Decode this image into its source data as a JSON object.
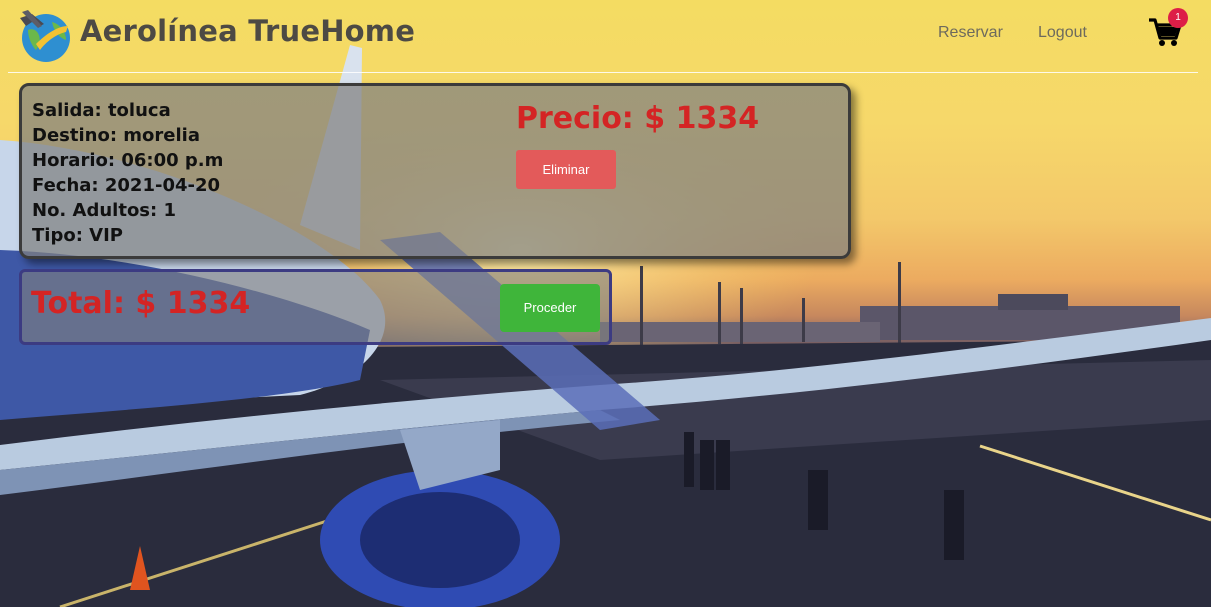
{
  "brand": {
    "name": "Aerolínea TrueHome",
    "logo_icon": "plane-globe-icon"
  },
  "nav": {
    "reservar": "Reservar",
    "logout": "Logout",
    "cart_icon": "shopping-cart-icon",
    "cart_count": "1"
  },
  "reservation": {
    "salida": "Salida: toluca",
    "destino": "Destino: morelia",
    "horario": "Horario: 06:00 p.m",
    "fecha": "Fecha: 2021-04-20",
    "adultos": "No. Adultos: 1",
    "tipo": "Tipo: VIP",
    "precio": "Precio: $ 1334",
    "eliminar_label": "Eliminar"
  },
  "summary": {
    "total": "Total: $ 1334",
    "proceder_label": "Proceder"
  },
  "colors": {
    "accent_red": "#d42424",
    "eliminar_button": "#e35a5a",
    "proceder_button": "#3fb53a",
    "badge": "#dd1e47"
  }
}
